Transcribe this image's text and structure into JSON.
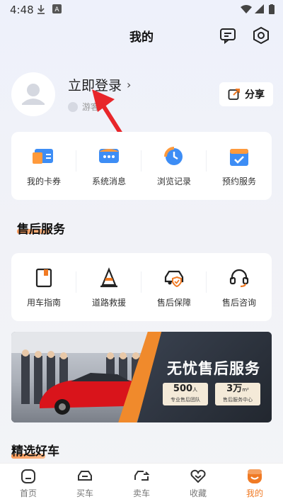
{
  "status_bar": {
    "time": "4:48"
  },
  "header": {
    "title": "我的"
  },
  "profile": {
    "login_text": "立即登录",
    "guest_label": "游客",
    "share_label": "分享"
  },
  "quick_menu": [
    {
      "label": "我的卡券",
      "icon": "coupon-icon"
    },
    {
      "label": "系统消息",
      "icon": "message-icon"
    },
    {
      "label": "浏览记录",
      "icon": "history-icon"
    },
    {
      "label": "预约服务",
      "icon": "calendar-icon"
    }
  ],
  "after_sales": {
    "title": "售后服务",
    "items": [
      {
        "label": "用车指南",
        "icon": "book-icon"
      },
      {
        "label": "道路救援",
        "icon": "cone-icon"
      },
      {
        "label": "售后保障",
        "icon": "car-shield-icon"
      },
      {
        "label": "售后咨询",
        "icon": "headset-icon"
      }
    ]
  },
  "banner": {
    "headline": "无忧售后服务",
    "stat1_value": "500",
    "stat1_unit": "人",
    "stat1_sub": "专业售后团队",
    "stat2_value": "3万",
    "stat2_unit": "m²",
    "stat2_sub": "售后服务中心"
  },
  "featured": {
    "title": "精选好车"
  },
  "tabbar": [
    {
      "label": "首页",
      "icon": "home-icon"
    },
    {
      "label": "买车",
      "icon": "buy-car-icon"
    },
    {
      "label": "卖车",
      "icon": "sell-car-icon"
    },
    {
      "label": "收藏",
      "icon": "favorite-icon"
    },
    {
      "label": "我的",
      "icon": "profile-icon",
      "active": true
    }
  ],
  "colors": {
    "accent": "#f07a24",
    "blue": "#3d8df5"
  }
}
